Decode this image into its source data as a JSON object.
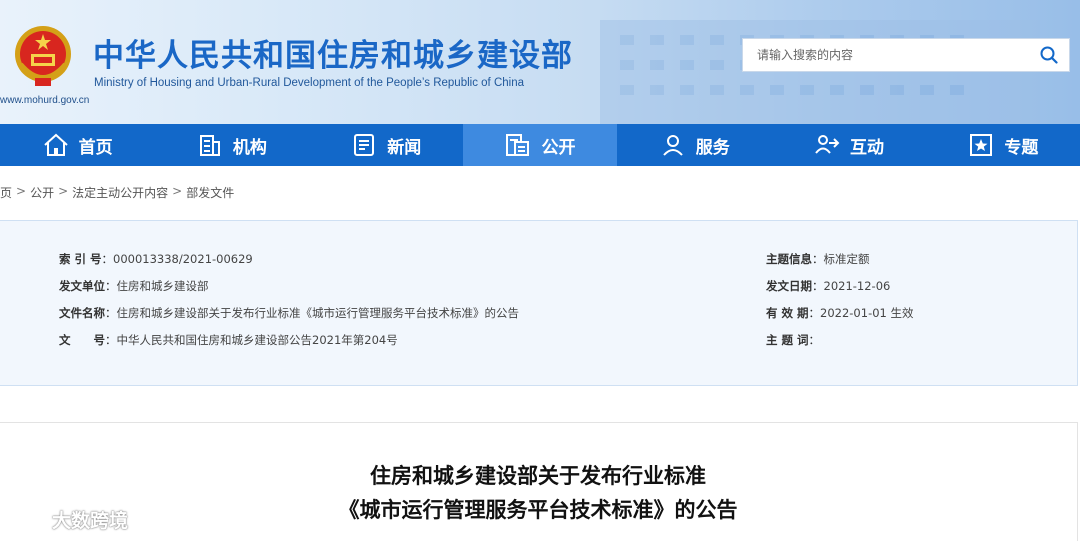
{
  "header": {
    "title": "中华人民共和国住房和城乡建设部",
    "subtitle": "Ministry of Housing and Urban-Rural Development of the People’s Republic of China",
    "url": "www.mohurd.gov.cn",
    "search_placeholder": "请输入搜索的内容"
  },
  "nav": [
    {
      "label": "首页",
      "icon": "home-icon"
    },
    {
      "label": "机构",
      "icon": "building-icon"
    },
    {
      "label": "新闻",
      "icon": "news-icon"
    },
    {
      "label": "公开",
      "icon": "disclosure-icon",
      "active": true
    },
    {
      "label": "服务",
      "icon": "service-icon"
    },
    {
      "label": "互动",
      "icon": "interaction-icon"
    },
    {
      "label": "专题",
      "icon": "topic-icon"
    }
  ],
  "breadcrumb": [
    "页",
    "公开",
    "法定主动公开内容",
    "部发文件"
  ],
  "info": {
    "index_label": "索 引 号",
    "index_value": "000013338/2021-00629",
    "issuer_label": "发文单位",
    "issuer_value": "住房和城乡建设部",
    "name_label": "文件名称",
    "name_value": "住房和城乡建设部关于发布行业标准《城市运行管理服务平台技术标准》的公告",
    "docno_label": "文　　号",
    "docno_value": "中华人民共和国住房和城乡建设部公告2021年第204号",
    "topic_label": "主题信息",
    "topic_value": "标准定额",
    "date_label": "发文日期",
    "date_value": "2021-12-06",
    "validity_label": "有 效 期",
    "validity_value": "2022-01-01 生效",
    "keywords_label": "主 题 词",
    "keywords_value": ""
  },
  "document": {
    "title_line1": "住房和城乡建设部关于发布行业标准",
    "title_line2": "《城市运行管理服务平台技术标准》的公告"
  },
  "watermark": {
    "text": "大数跨境"
  },
  "colors": {
    "nav_bg": "#1268c9",
    "nav_active": "#3e8ae0",
    "title_blue": "#1a67c6",
    "panel_bg": "#f2f7fd"
  }
}
